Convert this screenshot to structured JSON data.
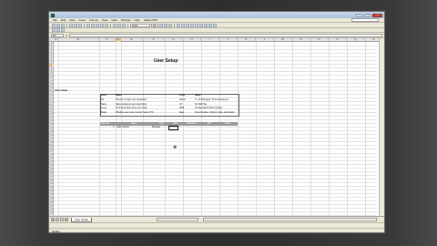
{
  "menu": [
    "File",
    "Edit",
    "View",
    "Insert",
    "Format",
    "Tools",
    "Data",
    "Window",
    "Help",
    "Adobe PDF"
  ],
  "font": {
    "name": "Arial",
    "size": "10"
  },
  "namebox": "D7",
  "sheet": {
    "title": "User Setup",
    "section_label": "Users Setup",
    "col_headers": [
      "A",
      "B",
      "C",
      "D",
      "E",
      "F",
      "G",
      "H",
      "I",
      "J",
      "K",
      "L",
      "M",
      "N",
      "O",
      "P",
      "Q",
      "R",
      "S",
      "T"
    ],
    "row_headers": [
      "1",
      "2",
      "3",
      "4",
      "5",
      "6",
      "7",
      "8",
      "9",
      "10",
      "11",
      "12",
      "13",
      "14",
      "15",
      "16",
      "17",
      "18",
      "19",
      "20",
      "21",
      "22",
      "23",
      "24",
      "25",
      "26",
      "27",
      "28",
      "29",
      "30",
      "31",
      "32",
      "33",
      "34",
      "35",
      "36",
      "37",
      "38",
      "39",
      "40",
      "41",
      "42",
      "43",
      "44",
      "45",
      "46",
      "47"
    ],
    "legend_headers": [
      "Field",
      "Name",
      "Code",
      "Name"
    ],
    "legend_rows": [
      [
        "No.",
        "Number or login user designator",
        "Admin",
        "S - for Managed, TF for Employees"
      ],
      [
        "Name",
        "Name assigned user description",
        "US",
        "No Staff Pay"
      ],
      [
        "Level",
        "ID of permission level user holds",
        "WEB",
        "On Equivalent Web interface"
      ],
      [
        "Mode",
        "Whether user code Journal mode of TF",
        "Date",
        "Determinative, ID Emp mode, permission"
      ]
    ],
    "band_headers": [
      "User No.",
      "Name",
      "Type",
      "Role",
      "Password",
      "EFT",
      "Notes"
    ],
    "data_rows": [
      [
        "1",
        "Adam Jarrett",
        "Manager"
      ]
    ]
  },
  "sheet_tab": "User Setup",
  "status": "Ready"
}
